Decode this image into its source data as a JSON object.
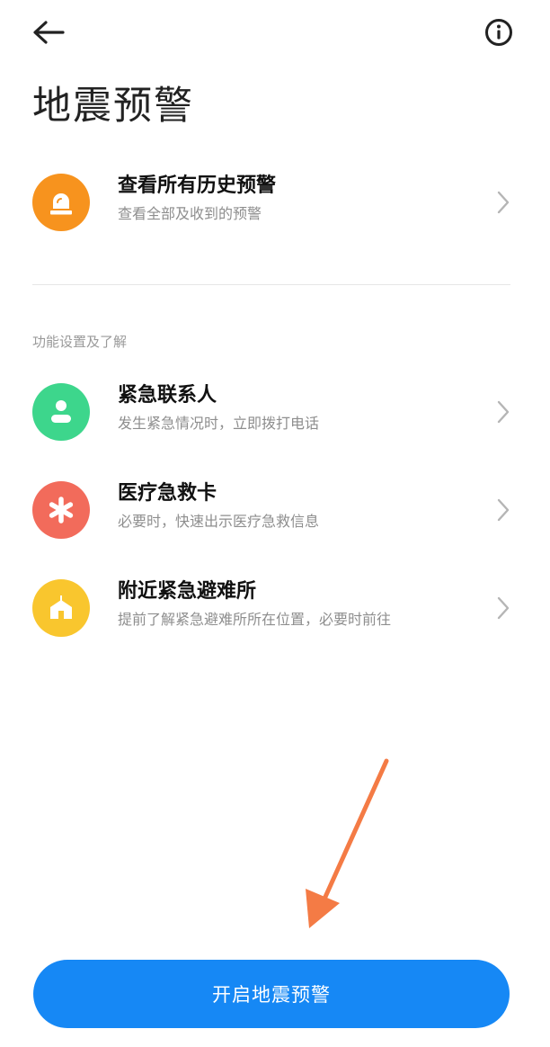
{
  "header": {
    "back_icon": "back-arrow-icon",
    "info_icon": "info-icon",
    "title": "地震预警"
  },
  "history": {
    "title": "查看所有历史预警",
    "subtitle": "查看全部及收到的预警",
    "icon": "alarm-light-icon",
    "color": "#F7931E"
  },
  "section": {
    "label": "功能设置及了解",
    "items": [
      {
        "title": "紧急联系人",
        "subtitle": "发生紧急情况时，立即拨打电话",
        "icon": "contact-person-icon",
        "color": "#3DD68C"
      },
      {
        "title": "医疗急救卡",
        "subtitle": "必要时，快速出示医疗急救信息",
        "icon": "medical-asterisk-icon",
        "color": "#F26B5B"
      },
      {
        "title": "附近紧急避难所",
        "subtitle": "提前了解紧急避难所所在位置，必要时前往",
        "icon": "shelter-house-icon",
        "color": "#F9C62E"
      }
    ]
  },
  "primary_button": {
    "label": "开启地震预警",
    "color": "#1688F5"
  },
  "annotation": {
    "arrow_color": "#F47B45"
  }
}
